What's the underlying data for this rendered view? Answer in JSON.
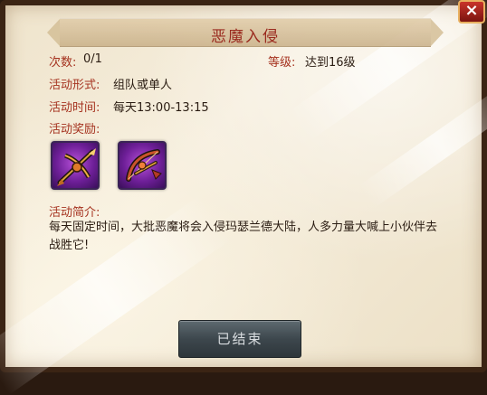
{
  "dialog": {
    "title": "恶魔入侵",
    "close_label": "×"
  },
  "info": {
    "times_label": "次数:",
    "times_value": "0/1",
    "level_label": "等级:",
    "level_value": "达到16级",
    "form_label": "活动形式:",
    "form_value": "组队或单人",
    "time_label": "活动时间:",
    "time_value": "每天13:00-13:15",
    "reward_label": "活动奖励:"
  },
  "rewards": [
    {
      "icon": "crossbow-weapon-icon",
      "rarity_color": "#8a2fb8"
    },
    {
      "icon": "bow-weapon-icon",
      "rarity_color": "#8a2fb8"
    }
  ],
  "description": {
    "label": "活动简介:",
    "text": "每天固定时间，大批恶魔将会入侵玛瑟兰德大陆，人多力量大喊上小伙伴去战胜它!"
  },
  "action": {
    "button_label": "已结束"
  }
}
